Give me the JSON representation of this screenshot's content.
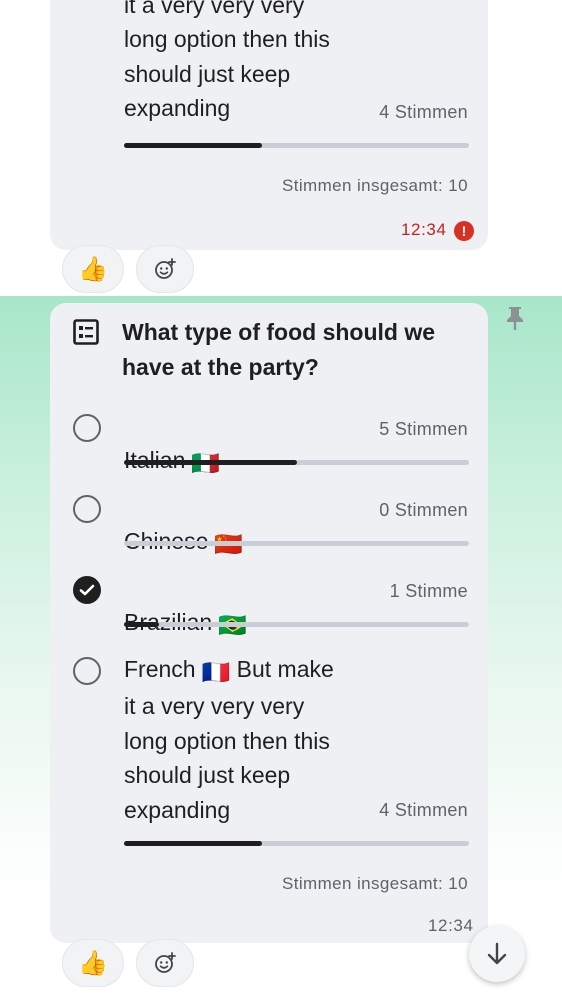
{
  "previous_message": {
    "option_text_lines": "it a very very very\nlong option then this\nshould just keep\nexpanding",
    "option_votes": "4 Stimmen",
    "option_fraction": 0.4,
    "total_votes": "Stimmen insgesamt: 10",
    "time": "12:34",
    "status": "error",
    "reactions": {
      "like": "👍",
      "add_reaction_icon": "add-reaction-icon"
    }
  },
  "poll_message": {
    "question": "What type of food should we have at the party?",
    "pinned": true,
    "options": [
      {
        "label": "Italian",
        "flag": "🇮🇹",
        "votes": "5 Stimmen",
        "fraction": 0.5,
        "selected": false
      },
      {
        "label": "Chinese",
        "flag": "🇨🇳",
        "votes": "0 Stimmen",
        "fraction": 0.0,
        "selected": false
      },
      {
        "label": "Brazilian",
        "flag": "🇧🇷",
        "votes": "1 Stimme",
        "fraction": 0.1,
        "selected": true
      },
      {
        "label_before_flag": "French",
        "flag": "🇫🇷",
        "label_after_flag": "But make\nit a very very very\nlong option then this\nshould just keep\nexpanding",
        "votes": "4 Stimmen",
        "fraction": 0.4,
        "selected": false
      }
    ],
    "total_votes": "Stimmen insgesamt: 10",
    "time": "12:34",
    "reactions": {
      "like": "👍",
      "add_reaction_icon": "add-reaction-icon"
    }
  },
  "colors": {
    "bubble": "#eef0f4",
    "highlight": "#a7e6c9",
    "bar_track": "#c9ced6",
    "bar_fill": "#1f1f1f",
    "error": "#d93025"
  }
}
